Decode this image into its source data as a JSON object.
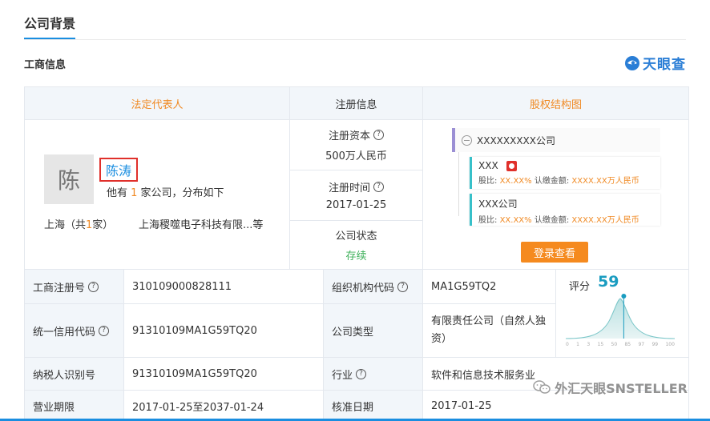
{
  "tab": {
    "label": "公司背景"
  },
  "section": {
    "title": "工商信息"
  },
  "brand": {
    "name": "天眼查",
    "color": "#2a7ed6"
  },
  "headers": {
    "legal_rep": "法定代表人",
    "registration": "注册信息",
    "equity": "股权结构图"
  },
  "legal_rep": {
    "avatar_char": "陈",
    "name": "陈涛",
    "desc_prefix": "他有 ",
    "desc_count": "1",
    "desc_suffix": " 家公司，分布如下",
    "location_prefix": "上海（共",
    "location_count": "1",
    "location_suffix": "家）",
    "companies": "上海稷噬电子科技有限...等"
  },
  "registration": {
    "capital_label": "注册资本",
    "capital_value": "500万人民币",
    "time_label": "注册时间",
    "time_value": "2017-01-25",
    "status_label": "公司状态",
    "status_value": "存续"
  },
  "equity": {
    "root": "XXXXXXXXX公司",
    "child1_name": "XXX",
    "child2_name": "XXX公司",
    "share_label": "股比:",
    "share_value": "XX.XX%",
    "subscribe_label": "认缴金额:",
    "subscribe_value": "XXXX.XX万人民币",
    "login_button": "登录查看"
  },
  "rows": [
    {
      "l1": "工商注册号",
      "l1q": true,
      "v1": "310109000828111",
      "l2": "组织机构代码",
      "l2q": true,
      "v2": "MA1G59TQ2"
    },
    {
      "l1": "统一信用代码",
      "l1q": true,
      "v1": "91310109MA1G59TQ20",
      "l2": "公司类型",
      "l2q": false,
      "v2": "有限责任公司（自然人独资）"
    },
    {
      "l1": "纳税人识别号",
      "l1q": false,
      "v1": "91310109MA1G59TQ20",
      "l2": "行业",
      "l2q": true,
      "v2": "软件和信息技术服务业"
    },
    {
      "l1": "营业期限",
      "l1q": false,
      "v1": "2017-01-25至2037-01-24",
      "l2": "核准日期",
      "l2q": false,
      "v2": "2017-01-25"
    }
  ],
  "score": {
    "label": "评分",
    "value": 59,
    "ticks": [
      "0",
      "1",
      "3",
      "15",
      "50",
      "85",
      "97",
      "99",
      "100"
    ]
  },
  "watermark": {
    "text": "外汇天眼SNSTELLER"
  },
  "colors": {
    "accent": "#1a8ee0",
    "orange": "#f08a24",
    "green": "#3db05a",
    "teal": "#37c0c9",
    "red": "#e0302b"
  }
}
